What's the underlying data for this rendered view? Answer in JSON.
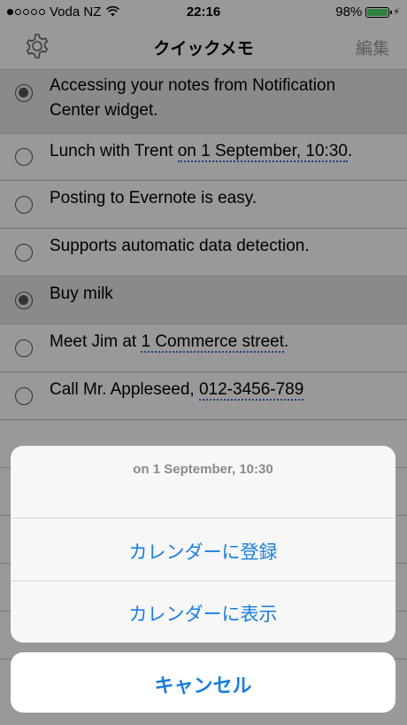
{
  "status_bar": {
    "carrier": "Voda NZ",
    "signal_bars_filled": 1,
    "signal_bars_total": 5,
    "time": "22:16",
    "battery_percent": "98%",
    "battery_level": 0.98
  },
  "nav": {
    "title": "クイックメモ",
    "edit_label": "編集"
  },
  "notes": [
    {
      "line1": "Accessing your notes from Notification",
      "line2": "Center widget.",
      "selected": true
    },
    {
      "pre": "Lunch with Trent ",
      "link": "on 1 September, 10:30",
      "post": ".",
      "selected": false
    },
    {
      "text": "Posting to Evernote is easy.",
      "selected": false
    },
    {
      "text": "Supports automatic data detection.",
      "selected": false
    },
    {
      "text": "Buy milk",
      "selected": true
    },
    {
      "pre": "Meet Jim at ",
      "link": "1 Commerce street",
      "post": ".",
      "selected": false
    },
    {
      "pre": "Call Mr. Appleseed, ",
      "link": "012-3456-789",
      "post": "",
      "selected": false
    }
  ],
  "action_sheet": {
    "title": "on 1 September, 10:30",
    "actions": [
      "カレンダーに登録",
      "カレンダーに表示"
    ],
    "cancel_label": "キャンセル"
  },
  "colors": {
    "accent": "#1a7ee0",
    "link_underline": "#3b66d6",
    "battery": "#4cd964"
  },
  "icons": [
    "signal-dots-icon",
    "wifi-icon",
    "battery-icon",
    "charging-bolt-icon",
    "gear-icon",
    "radio-icon"
  ]
}
